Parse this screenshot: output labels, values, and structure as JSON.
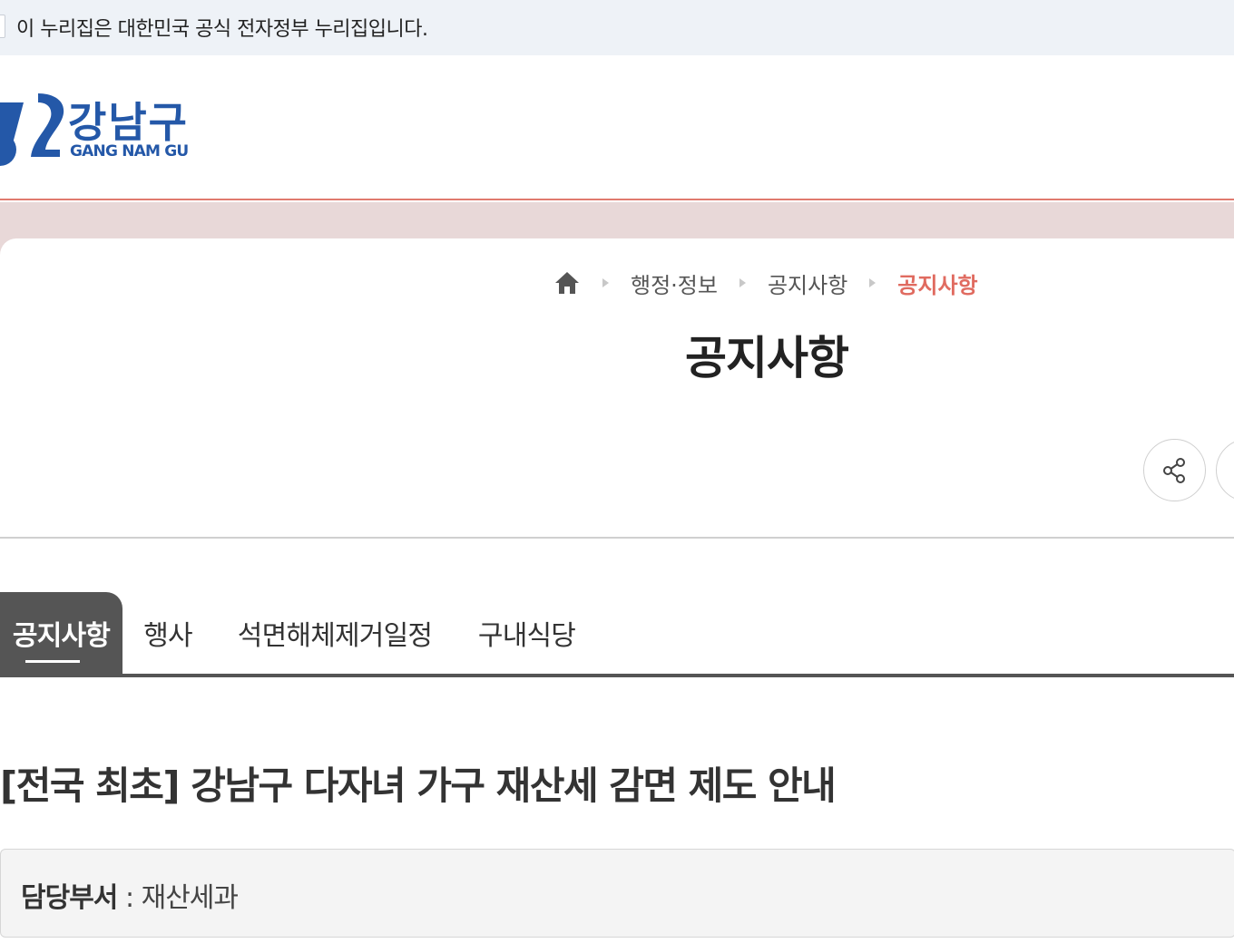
{
  "gov_banner": {
    "text": "이 누리집은 대한민국 공식 전자정부 누리집입니다."
  },
  "logo": {
    "ko": "강남구",
    "en": "GANG NAM GU",
    "color": "#2458a8"
  },
  "breadcrumb": {
    "items": [
      "행정·정보",
      "공지사항",
      "공지사항"
    ],
    "current_color": "#e06b60"
  },
  "page_title": "공지사항",
  "tabs": [
    {
      "label": "공지사항",
      "active": true
    },
    {
      "label": "행사",
      "active": false
    },
    {
      "label": "석면해체제거일정",
      "active": false
    },
    {
      "label": "구내식당",
      "active": false
    }
  ],
  "article": {
    "title": "[전국 최초] 강남구 다자녀 가구 재산세 감면 제도 안내",
    "dept_label": "담당부서",
    "dept_sep": " : ",
    "dept_value": "재산세과"
  },
  "icons": {
    "home": "home-icon",
    "share": "share-icon"
  }
}
